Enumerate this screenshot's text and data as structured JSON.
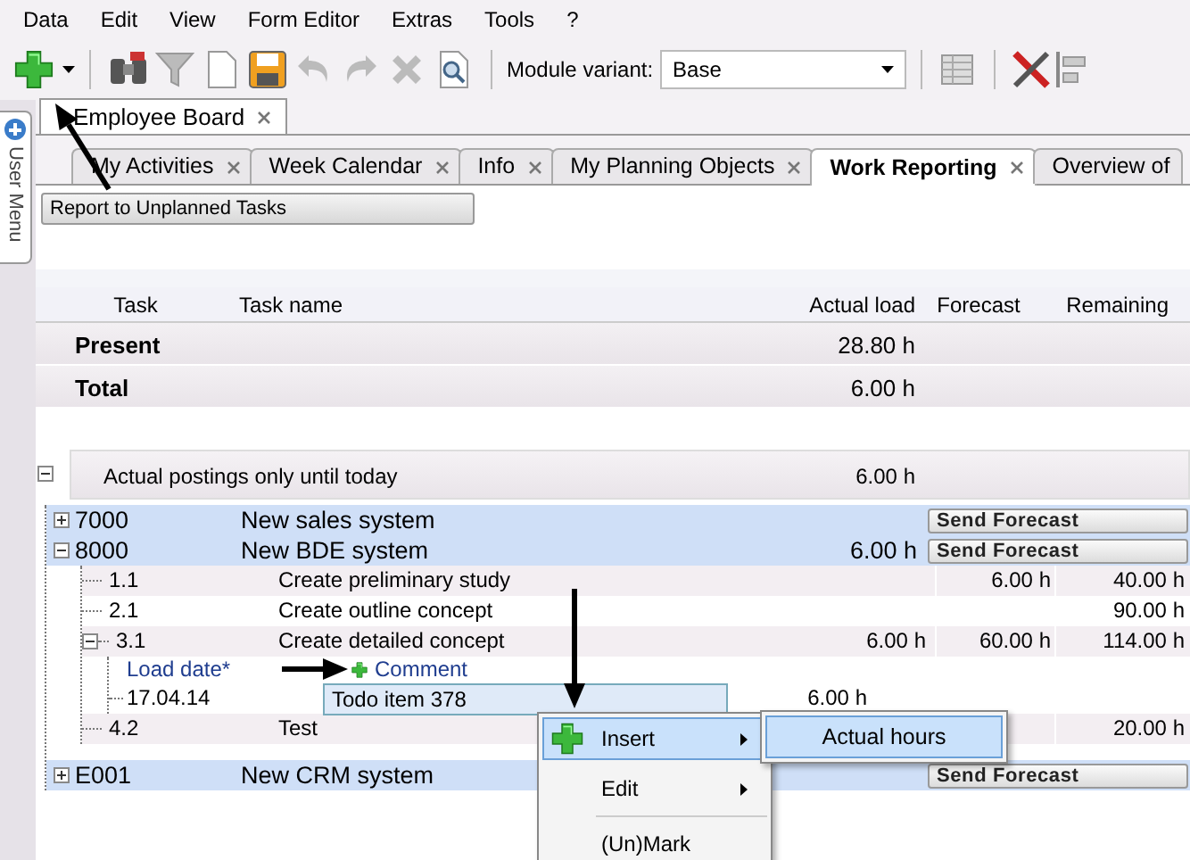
{
  "menu_bar": [
    "Data",
    "Edit",
    "View",
    "Form Editor",
    "Extras",
    "Tools",
    "?"
  ],
  "toolbar": {
    "module_variant_label": "Module variant:",
    "module_variant": "Base"
  },
  "side_tab": "User Menu",
  "document_tabs": [
    {
      "label": "Employee Board",
      "selected": true
    }
  ],
  "tabs": [
    {
      "label": "My Activities",
      "selected": false
    },
    {
      "label": "Week Calendar",
      "selected": false
    },
    {
      "label": "Info",
      "selected": false
    },
    {
      "label": "My Planning Objects",
      "selected": false
    },
    {
      "label": "Work Reporting",
      "selected": true
    },
    {
      "label": "Overview of",
      "selected": false
    }
  ],
  "report_button": "Report to Unplanned Tasks",
  "grid": {
    "columns": [
      "Task",
      "Task name",
      "Actual load",
      "Forecast",
      "Remaining"
    ],
    "summary_rows": [
      {
        "label": "Present",
        "actual_load": "28.80 h"
      },
      {
        "label": "Total",
        "actual_load": "6.00 h"
      }
    ],
    "group": {
      "label": "Actual postings only until today",
      "actual_load": "6.00 h",
      "expanded": true
    },
    "tree": [
      {
        "task": "7000",
        "name": "New sales system",
        "button": "Send Forecast",
        "expanded": false
      },
      {
        "task": "8000",
        "name": "New BDE system",
        "actual_load": "6.00 h",
        "button": "Send Forecast",
        "expanded": true,
        "children": [
          {
            "task": "1.1",
            "name": "Create preliminary study",
            "forecast": "6.00 h",
            "remaining": "40.00 h",
            "shaded": true
          },
          {
            "task": "2.1",
            "name": "Create outline concept",
            "remaining": "90.00 h",
            "shaded": false
          },
          {
            "task": "3.1",
            "name": "Create detailed concept",
            "actual_load": "6.00 h",
            "forecast": "60.00 h",
            "remaining": "114.00 h",
            "shaded": true,
            "expanded": true,
            "bookings": {
              "columns": [
                "Load date*",
                "Comment"
              ],
              "rows": [
                {
                  "date": "17.04.14",
                  "comment": "Todo item 378",
                  "actual_load": "6.00 h"
                }
              ]
            }
          },
          {
            "task": "4.2",
            "name": "Test",
            "remaining": "20.00 h",
            "shaded": true
          }
        ]
      },
      {
        "task": "E001",
        "name": "New CRM system",
        "button": "Send Forecast",
        "expanded": false
      }
    ]
  },
  "context_menu": {
    "items": [
      {
        "kind": "item",
        "label": "Insert",
        "icon": true,
        "submenu": true,
        "selected": true
      },
      {
        "kind": "item",
        "label": "Edit",
        "submenu": true,
        "selected": false
      },
      {
        "kind": "separator"
      },
      {
        "kind": "item",
        "label": "(Un)Mark",
        "submenu": false,
        "selected": false
      }
    ],
    "submenu": [
      {
        "label": "Actual hours",
        "selected": true
      }
    ]
  }
}
